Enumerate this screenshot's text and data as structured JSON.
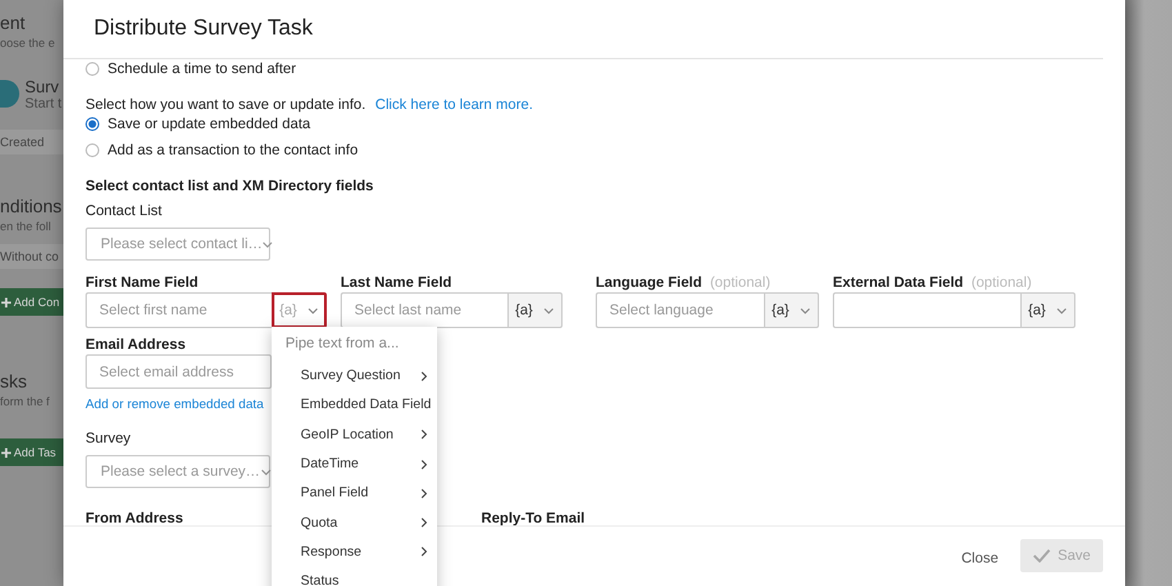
{
  "background_page": {
    "items": [
      {
        "kind": "heading",
        "text": "ent"
      },
      {
        "kind": "subtext",
        "text": "oose the e"
      },
      {
        "kind": "card",
        "title": "Surv",
        "subtitle": "Start t"
      },
      {
        "kind": "row",
        "text": "Created"
      },
      {
        "kind": "heading",
        "text": "nditions"
      },
      {
        "kind": "subtext",
        "text": "en the foll"
      },
      {
        "kind": "row",
        "text": "Without co"
      },
      {
        "kind": "button",
        "text": "Add Con"
      },
      {
        "kind": "heading",
        "text": "sks"
      },
      {
        "kind": "subtext",
        "text": "form the f"
      },
      {
        "kind": "button",
        "text": "Add Tas"
      }
    ]
  },
  "modal": {
    "title": "Distribute Survey Task",
    "send_options": [
      {
        "label": "Schedule a time to send after",
        "selected": false
      }
    ],
    "save_prompt": "Select how you want to save or update info.",
    "learn_more_link": "Click here to learn more.",
    "save_options": [
      {
        "label": "Save or update embedded data",
        "selected": true
      },
      {
        "label": "Add as a transaction to the contact info",
        "selected": false
      }
    ],
    "section_heading": "Select contact list and XM Directory fields",
    "contact_list": {
      "label": "Contact List",
      "placeholder": "Please select contact li…"
    },
    "fields": [
      {
        "label": "First Name Field",
        "placeholder": "Select first name",
        "pipe_button": "{a}",
        "open": true
      },
      {
        "label": "Last Name Field",
        "placeholder": "Select last name",
        "pipe_button": "{a}",
        "open": false
      },
      {
        "label": "Language Field",
        "hint": "(optional)",
        "placeholder": "Select language",
        "pipe_button": "{a}",
        "open": false
      },
      {
        "label": "External Data Field",
        "hint": "(optional)",
        "pipe_button": "{a}",
        "open": false
      }
    ],
    "email": {
      "label": "Email Address",
      "placeholder": "Select email address"
    },
    "embedded_data_link": "Add or remove embedded data",
    "survey": {
      "label": "Survey",
      "placeholder": "Please select a survey…"
    },
    "bottom_fields": [
      {
        "label": "From Address"
      },
      {
        "label": "Reply-To Email"
      }
    ],
    "pipe_menu": {
      "header": "Pipe text from a...",
      "items": [
        {
          "label": "Survey Question",
          "has_submenu": true
        },
        {
          "label": "Embedded Data Field",
          "has_submenu": false
        },
        {
          "label": "GeoIP Location",
          "has_submenu": true
        },
        {
          "label": "DateTime",
          "has_submenu": true
        },
        {
          "label": "Panel Field",
          "has_submenu": true
        },
        {
          "label": "Quota",
          "has_submenu": true
        },
        {
          "label": "Response",
          "has_submenu": true
        },
        {
          "label": "Status",
          "has_submenu": false
        }
      ]
    },
    "footer": {
      "close": "Close",
      "save": {
        "label": "Save",
        "disabled": true
      }
    }
  }
}
